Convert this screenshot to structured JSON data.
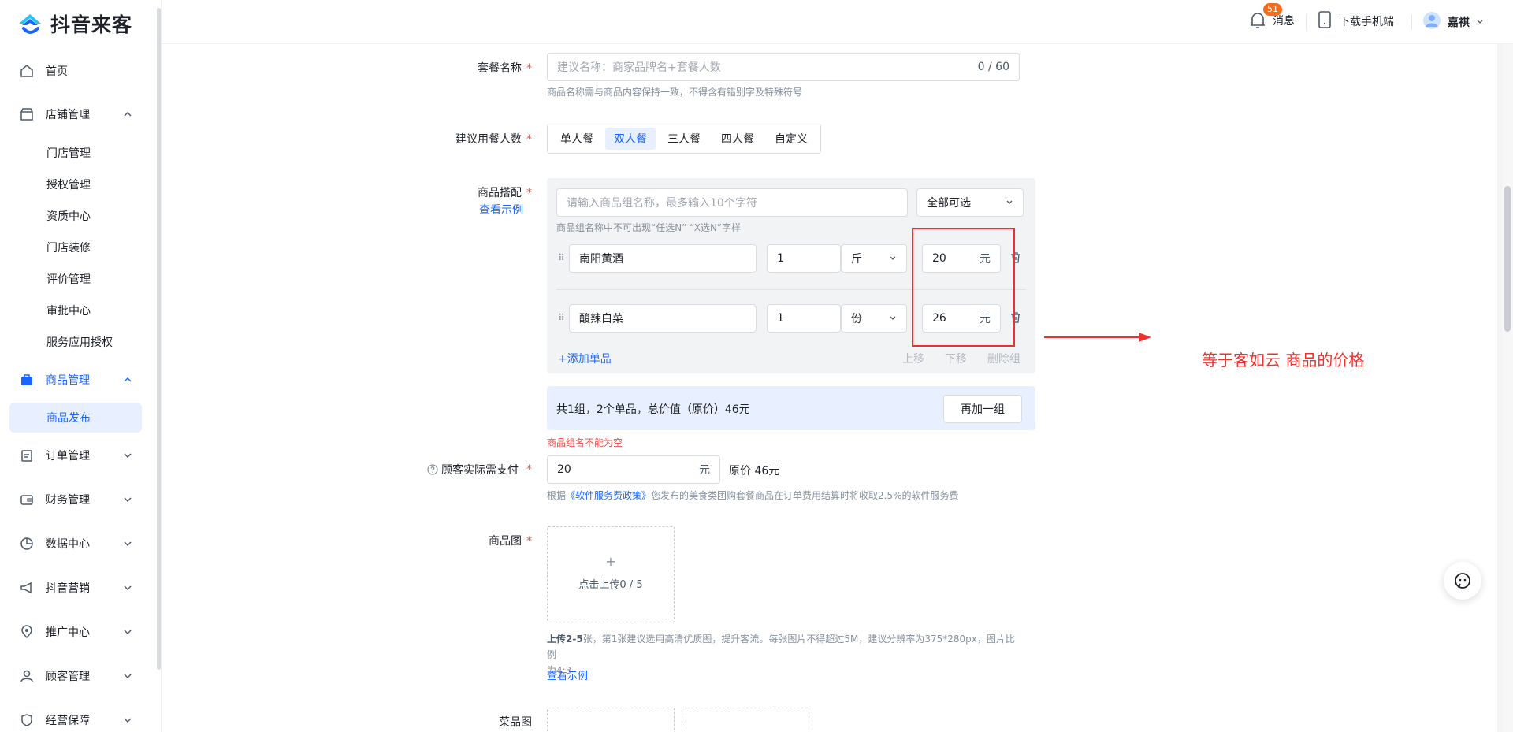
{
  "app": {
    "name": "抖音来客"
  },
  "sidebar": {
    "items": [
      {
        "label": "首页"
      },
      {
        "label": "店铺管理"
      },
      {
        "label": "商品管理"
      },
      {
        "label": "订单管理"
      },
      {
        "label": "财务管理"
      },
      {
        "label": "数据中心"
      },
      {
        "label": "抖音营销"
      },
      {
        "label": "推广中心"
      },
      {
        "label": "顾客管理"
      },
      {
        "label": "经营保障"
      }
    ],
    "store_sub": [
      "门店管理",
      "授权管理",
      "资质中心",
      "门店装修",
      "评价管理",
      "审批中心",
      "服务应用授权"
    ],
    "product_sub": [
      "商品发布"
    ]
  },
  "topbar": {
    "message_label": "消息",
    "message_badge": "51",
    "download_label": "下载手机端",
    "user_name": "嘉祺"
  },
  "form": {
    "package_name": {
      "label": "套餐名称",
      "placeholder": "建议名称：商家品牌名+套餐人数",
      "counter": "0 / 60",
      "hint": "商品名称需与商品内容保持一致，不得含有错别字及特殊符号"
    },
    "diners": {
      "label": "建议用餐人数",
      "options": [
        "单人餐",
        "双人餐",
        "三人餐",
        "四人餐",
        "自定义"
      ],
      "selected": "双人餐"
    },
    "combo": {
      "label": "商品搭配",
      "example_link": "查看示例",
      "group_name_placeholder": "请输入商品组名称，最多输入10个字符",
      "group_mode": "全部可选",
      "group_hint": "商品组名称中不可出现“任选N” “X选N”字样",
      "items": [
        {
          "name": "南阳黄酒",
          "qty": "1",
          "unit": "斤",
          "price": "20",
          "currency": "元"
        },
        {
          "name": "酸辣白菜",
          "qty": "1",
          "unit": "份",
          "price": "26",
          "currency": "元"
        }
      ],
      "add_item": "+添加单品",
      "move_up": "上移",
      "move_down": "下移",
      "delete_group": "删除组",
      "summary": "共1组，2个单品，总价值（原价）46元",
      "add_group": "再加一组",
      "error": "商品组名不能为空"
    },
    "pay": {
      "label": "顾客实际需支付",
      "value": "20",
      "currency": "元",
      "original": "原价 46元",
      "hint_prefix": "根据",
      "hint_link": "《软件服务费政策》",
      "hint_suffix": "您发布的美食类团购套餐商品在订单费用结算时将收取2.5%的软件服务费"
    },
    "images": {
      "label": "商品图",
      "upload_text": "点击上传0 / 5",
      "hint_line1_bold": "上传2-5",
      "hint_line1": "张，第1张建议选用高清优质图，提升客流。每张图片不得超过5M，建议分辨率为375*280px，图片比例",
      "hint_line2": "为4:3",
      "example_link": "查看示例"
    },
    "dish_images": {
      "label": "菜品图"
    }
  },
  "annotation": {
    "text": "等于客如云 商品的价格"
  },
  "colors": {
    "accent": "#1966ff",
    "annotation": "#f0312a",
    "required": "#f54a45"
  }
}
